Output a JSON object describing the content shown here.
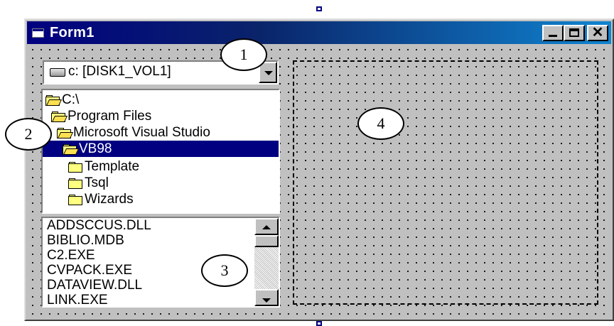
{
  "window": {
    "title": "Form1",
    "controls": {
      "minimize_icon": "minimize-icon",
      "maximize_icon": "maximize-icon",
      "close_glyph": "✕"
    }
  },
  "drive_combo": {
    "value": "c: [DISK1_VOL1]",
    "icon": "hard-drive-icon"
  },
  "directory_list": {
    "items": [
      {
        "label": "C:\\",
        "icon": "open-folder-icon"
      },
      {
        "label": "Program Files",
        "icon": "open-folder-icon"
      },
      {
        "label": "Microsoft Visual Studio",
        "icon": "open-folder-icon"
      },
      {
        "label": "VB98",
        "icon": "open-folder-icon",
        "selected": true
      },
      {
        "label": "Template",
        "icon": "folder-icon"
      },
      {
        "label": "Tsql",
        "icon": "folder-icon"
      },
      {
        "label": "Wizards",
        "icon": "folder-icon"
      }
    ]
  },
  "file_list": {
    "items": [
      "ADDSCCUS.DLL",
      "BIBLIO.MDB",
      "C2.EXE",
      "CVPACK.EXE",
      "DATAVIEW.DLL",
      "LINK.EXE"
    ]
  },
  "callouts": [
    "1",
    "2",
    "3",
    "4"
  ],
  "colors": {
    "title_bar": "#000080",
    "selection": "#000080",
    "form_background": "#c0c0c0"
  }
}
